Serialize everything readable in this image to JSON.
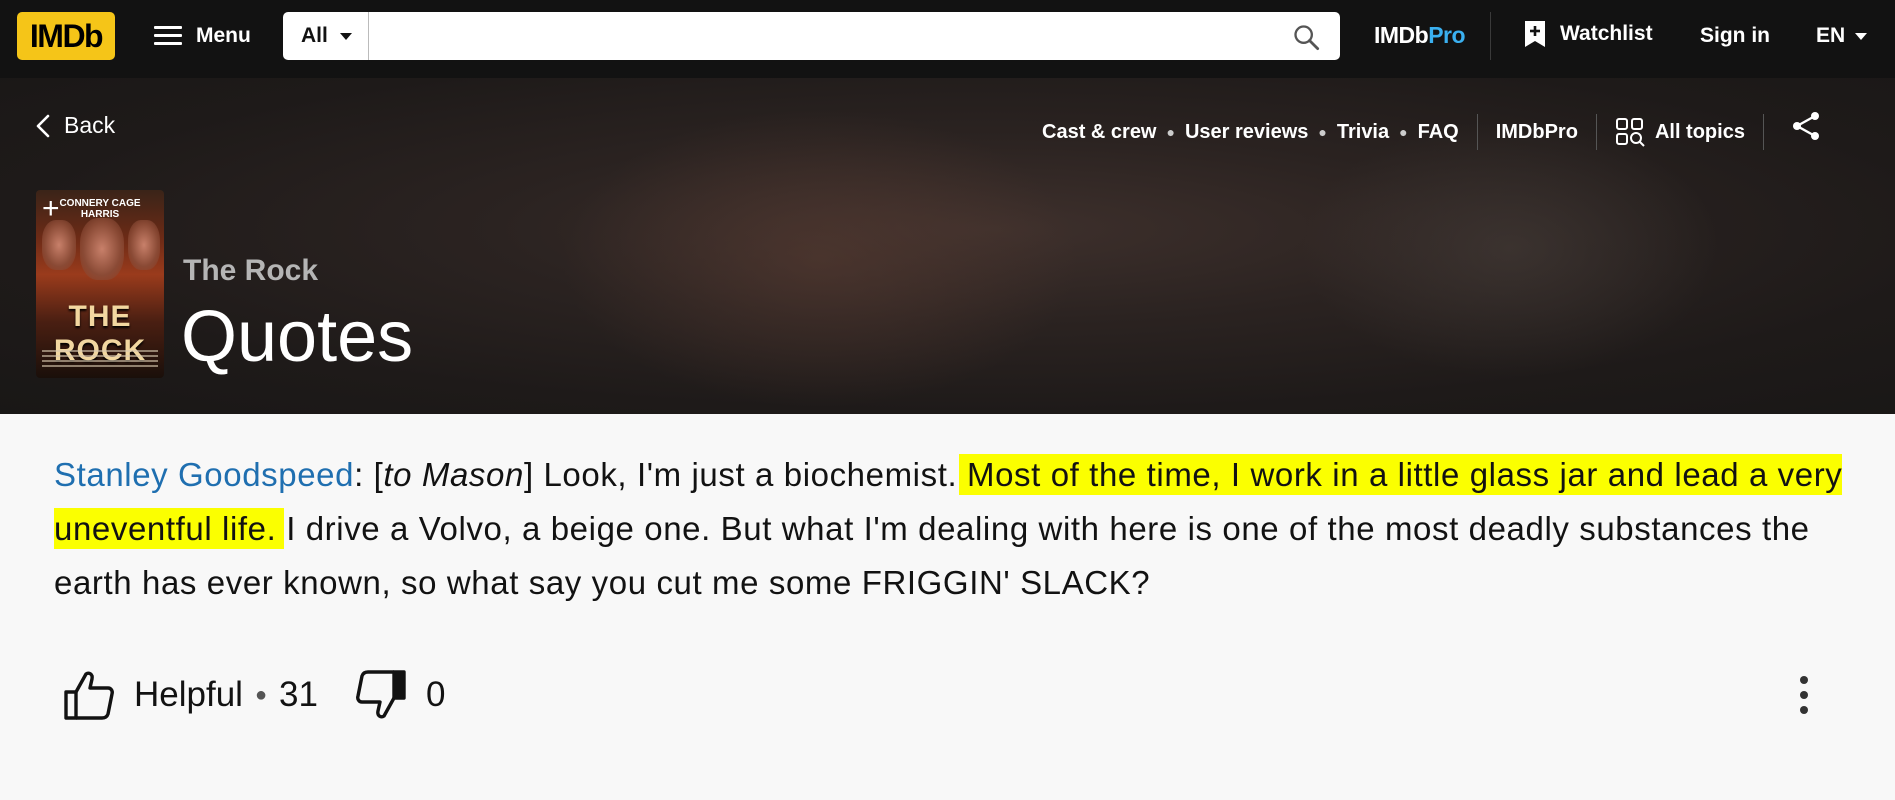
{
  "navbar": {
    "logo_text": "IMDb",
    "menu_label": "Menu",
    "search": {
      "category": "All",
      "placeholder": ""
    },
    "imdbpro": {
      "part1": "IMDb",
      "part2": "Pro"
    },
    "watchlist_label": "Watchlist",
    "signin_label": "Sign in",
    "language": "EN"
  },
  "hero": {
    "back_label": "Back",
    "subnav": [
      "Cast & crew",
      "User reviews",
      "Trivia",
      "FAQ"
    ],
    "imdbpro_link": "IMDbPro",
    "all_topics_label": "All topics",
    "movie_title": "The Rock",
    "page_title": "Quotes",
    "poster": {
      "names": "CONNERY CAGE HARRIS",
      "title": "THE ROCK"
    }
  },
  "quote": {
    "character": "Stanley Goodspeed",
    "colon": ": [",
    "stage_direction": "to Mason",
    "bracket_close": "] Look, I'm just a biochemist. ",
    "highlighted": "Most of the time, I work in a little glass jar and lead a very uneventful life.",
    "rest": " I drive a Volvo, a beige one. But what I'm dealing with here is one of the most deadly substances the earth has ever known, so what say you cut me some FRIGGIN' SLACK?"
  },
  "actions": {
    "helpful_label": "Helpful",
    "helpful_count": "31",
    "unhelpful_count": "0"
  },
  "colors": {
    "imdb_yellow": "#f5c518",
    "link_blue": "#1f6fb0",
    "highlight": "#fbff00",
    "pro_blue": "#3ab0f0"
  },
  "icons": [
    "hamburger-icon",
    "caret-down-icon",
    "search-icon",
    "watchlist-add-icon",
    "chevron-left-icon",
    "all-topics-icon",
    "share-icon",
    "thumbs-up-icon",
    "thumbs-down-icon",
    "more-options-icon",
    "add-to-watchlist-icon"
  ]
}
